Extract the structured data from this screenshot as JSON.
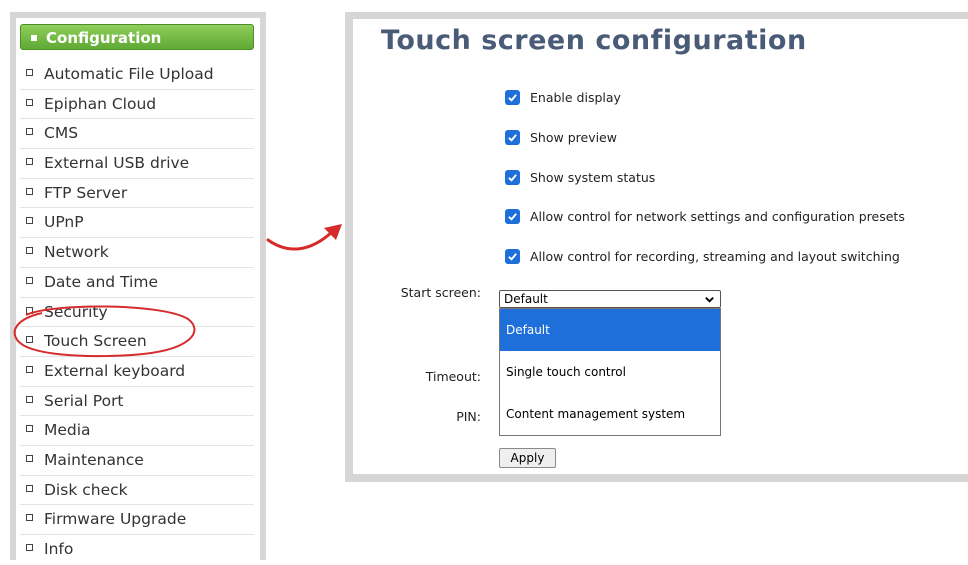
{
  "sidebar": {
    "header": "Configuration",
    "items": [
      {
        "label": "Automatic File Upload"
      },
      {
        "label": "Epiphan Cloud"
      },
      {
        "label": "CMS"
      },
      {
        "label": "External USB drive"
      },
      {
        "label": "FTP Server"
      },
      {
        "label": "UPnP"
      },
      {
        "label": "Network"
      },
      {
        "label": "Date and Time"
      },
      {
        "label": "Security"
      },
      {
        "label": "Touch Screen"
      },
      {
        "label": "External keyboard"
      },
      {
        "label": "Serial Port"
      },
      {
        "label": "Media"
      },
      {
        "label": "Maintenance"
      },
      {
        "label": "Disk check"
      },
      {
        "label": "Firmware Upgrade"
      },
      {
        "label": "Info"
      }
    ]
  },
  "main": {
    "title": "Touch screen configuration",
    "checkboxes": [
      {
        "label": "Enable display",
        "checked": true
      },
      {
        "label": "Show preview",
        "checked": true
      },
      {
        "label": "Show system status",
        "checked": true
      },
      {
        "label": "Allow control for network settings and configuration presets",
        "checked": true
      },
      {
        "label": "Allow control for recording, streaming and layout switching",
        "checked": true
      }
    ],
    "start_screen": {
      "label": "Start screen:",
      "value": "Default",
      "options": [
        "Default",
        "Single touch control",
        "Content management system"
      ]
    },
    "timeout_label": "Timeout:",
    "pin_label": "PIN:",
    "apply_label": "Apply"
  },
  "colors": {
    "accent": "#1e6fd9",
    "header_green": "#6cb83e",
    "title_blue": "#4a5b78",
    "annotation_red": "#d62b2b"
  }
}
